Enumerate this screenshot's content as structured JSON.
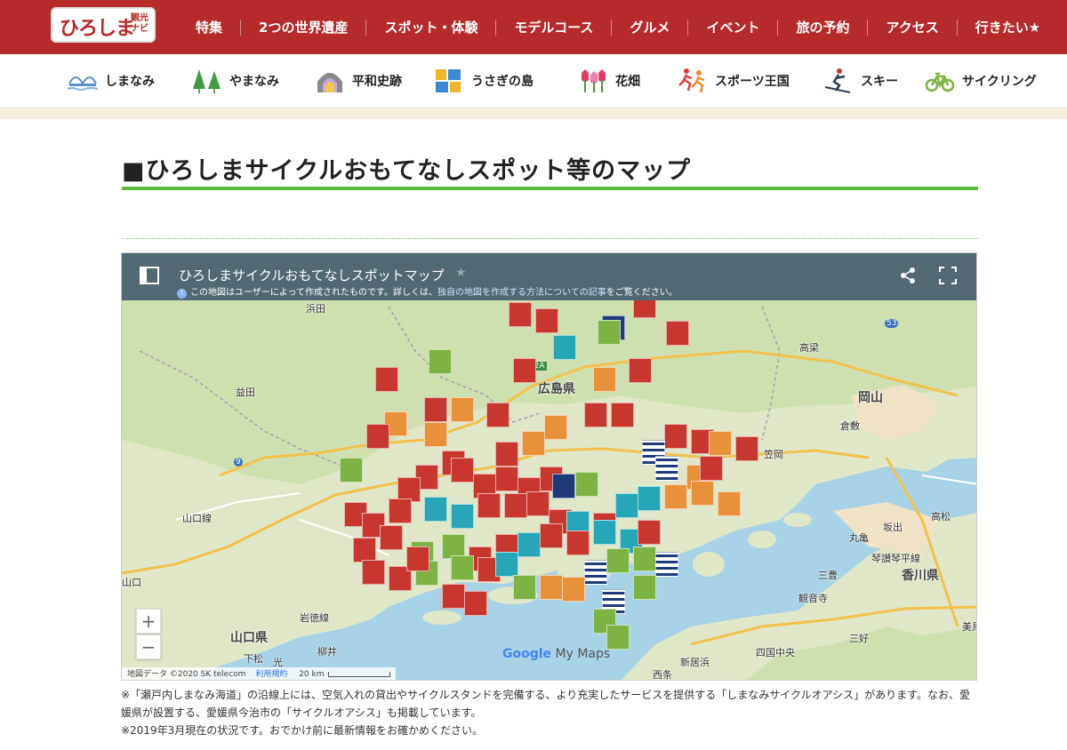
{
  "header": {
    "logo_main": "ひろしま",
    "logo_sub": "観光ナビ",
    "nav": [
      "特集",
      "2つの世界遺産",
      "スポット・体験",
      "モデルコース",
      "グルメ",
      "イベント",
      "旅の予約",
      "アクセス",
      "行きたい★"
    ]
  },
  "categories": [
    {
      "label": "しまなみ",
      "icon": "bridge-icon"
    },
    {
      "label": "やまなみ",
      "icon": "trees-icon"
    },
    {
      "label": "平和史跡",
      "icon": "dome-icon"
    },
    {
      "label": "うさぎの島",
      "icon": "rabbit-icon"
    },
    {
      "label": "花畑",
      "icon": "tulip-icon"
    },
    {
      "label": "スポーツ王国",
      "icon": "runner-icon"
    },
    {
      "label": "スキー",
      "icon": "skier-icon"
    },
    {
      "label": "サイクリング",
      "icon": "bicycle-icon"
    }
  ],
  "page_title": "■ひろしまサイクルおもてなしスポット等のマップ",
  "map": {
    "title": "ひろしまサイクルおもてなしスポットマップ",
    "info_prefix": "この地図はユーザーによって作成されたものです。詳しくは、",
    "info_link": "独自の地図を作成する方法についての記事",
    "info_suffix": "をご覧ください。",
    "zoom_in": "+",
    "zoom_out": "−",
    "attribution": "地図データ ©2020 SK telecom",
    "terms": "利用規約",
    "scale": "20 km",
    "google": "Google",
    "mymaps": "My Maps",
    "labels": {
      "hamada": "浜田",
      "masuda": "益田",
      "hiroshima_pref": "広島県",
      "kasaoka": "笠岡",
      "okayama": "岡山",
      "kurashiki": "倉敷",
      "yamaguchi_line": "山口線",
      "yamaguchi": "山口",
      "yamaguchi_pref": "山口県",
      "iwatoku_line": "岩徳線",
      "shimomatsu": "下松",
      "hikari": "光",
      "yanai": "柳井",
      "takahashi": "高梁",
      "takamatsu": "高松",
      "sakaide": "坂出",
      "marugame": "丸亀",
      "yosan_line": "琴讃琴平線",
      "mitoyo": "三豊",
      "kagawa_pref": "香川県",
      "kanonji": "観音寺",
      "niihama": "新居浜",
      "saijo": "西条",
      "shikokuchuo": "四国中央",
      "miyoshi": "三好",
      "mima": "美馬",
      "e2a": "E2A",
      "r53": "53",
      "r9": "9"
    },
    "marker_colors": {
      "food": "#c8372d",
      "cycle": "#7cb342",
      "repair": "#26a6b6",
      "rest": "#e8913a",
      "stand": "#ffffff",
      "oasis": "#1f3a7a"
    }
  },
  "notes": [
    "※「瀬戸内しまなみ海道」の沿線上には、空気入れの貸出やサイクルスタンドを完備する、より充実したサービスを提供する「しまなみサイクルオアシス」があります。なお、愛媛県が設置する、愛媛県今治市の「サイクルオアシス」も掲載しています。",
    "※2019年3月現在の状況です。おでかけ前に最新情報をお確かめください。"
  ]
}
